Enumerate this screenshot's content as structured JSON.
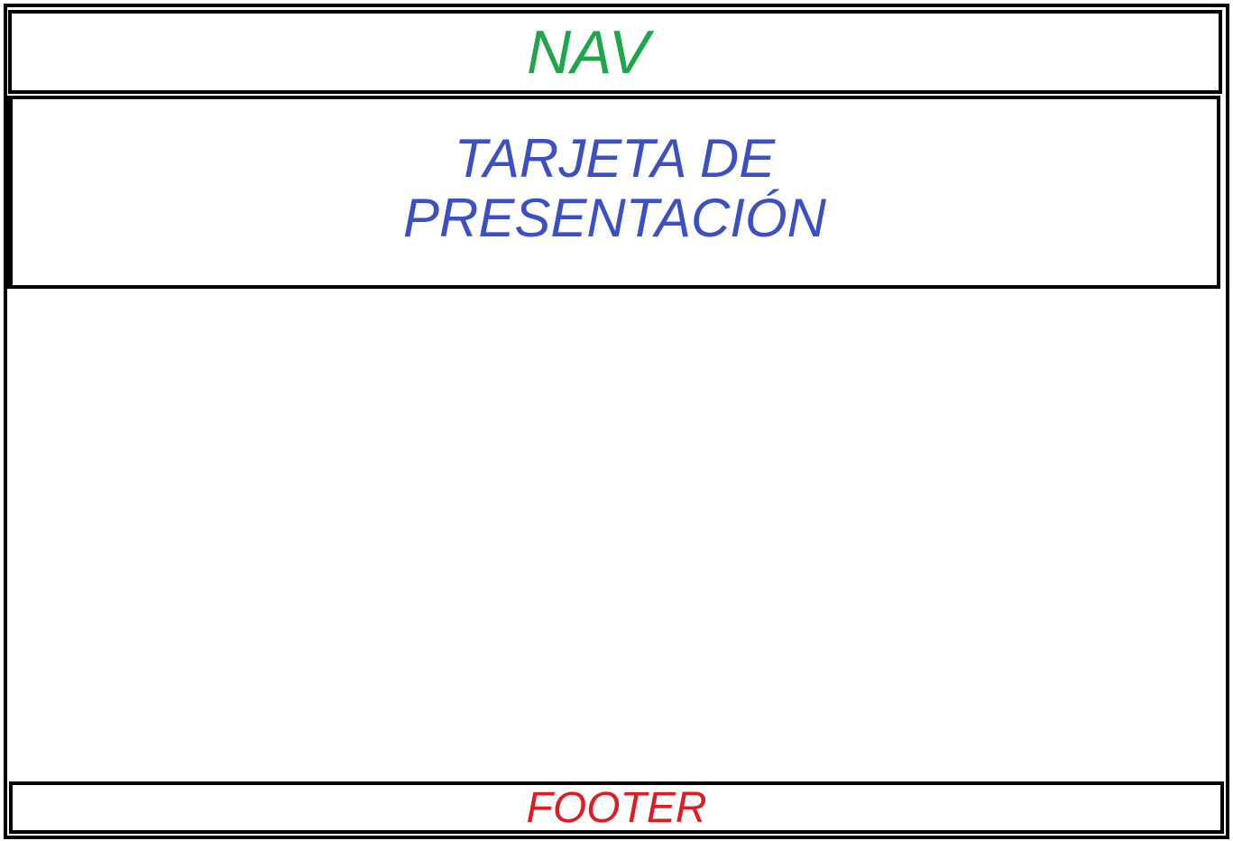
{
  "nav": {
    "label": "NAV",
    "color": "#1fa64a"
  },
  "hero": {
    "line1": "TARJETA DE",
    "line2": "PRESENTACIÓN",
    "color": "#3c4fc4"
  },
  "footer": {
    "label": "FOOTER",
    "color": "#e11b22"
  }
}
